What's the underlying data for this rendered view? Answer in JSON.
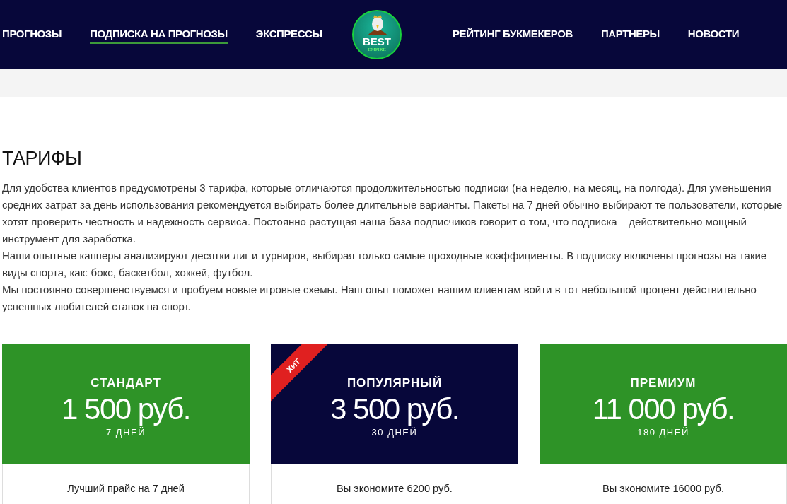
{
  "nav_left": [
    {
      "label": "ПРОГНОЗЫ",
      "selected": false
    },
    {
      "label": "ПОДПИСКА НА ПРОГНОЗЫ",
      "selected": true
    },
    {
      "label": "ЭКСПРЕССЫ",
      "selected": false
    }
  ],
  "logo": {
    "title": "BEST",
    "subtitle": "EMPIRE"
  },
  "nav_right": [
    {
      "label": "РЕЙТИНГ БУКМЕКЕРОВ",
      "selected": false
    },
    {
      "label": "ПАРТНЕРЫ",
      "selected": false
    },
    {
      "label": "НОВОСТИ",
      "selected": false
    }
  ],
  "heading": "ТАРИФЫ",
  "paragraphs": [
    "Для удобства клиентов предусмотрены 3 тарифа, которые отличаются продолжительностью подписки (на неделю, на месяц, на полгода). Для уменьшения средних затрат за день использования рекомендуется выбирать более длительные варианты. Пакеты на 7 дней обычно выбирают те пользователи, которые хотят проверить честность и надежность сервиса. Постоянно растущая наша база подписчиков говорит о том, что подписка – действительно мощный инструмент для заработка.",
    "Наши опытные капперы анализируют десятки лиг и турниров, выбирая только самые проходные коэффициенты. В подписку включены прогнозы на такие виды спорта, как: бокс, баскетбол, хоккей, футбол.",
    "Мы постоянно совершенствуемся и пробуем новые игровые схемы. Наш опыт поможет нашим клиентам войти в тот небольшой процент действительно успешных любителей ставок на спорт."
  ],
  "plans": [
    {
      "name": "СТАНДАРТ",
      "price": "1 500 руб.",
      "period": "7 ДНЕЙ",
      "color": "#2e9327",
      "note": "Лучший прайс на 7 дней"
    },
    {
      "name": "ПОПУЛЯРНЫЙ",
      "price": "3 500 руб.",
      "period": "30 ДНЕЙ",
      "color": "#07073a",
      "badge": "ХИТ",
      "note": "Вы экономите 6200 руб."
    },
    {
      "name": "ПРЕМИУМ",
      "price": "11 000 руб.",
      "period": "180 ДНЕЙ",
      "color": "#2e9327",
      "note": "Вы экономите 16000 руб."
    }
  ]
}
